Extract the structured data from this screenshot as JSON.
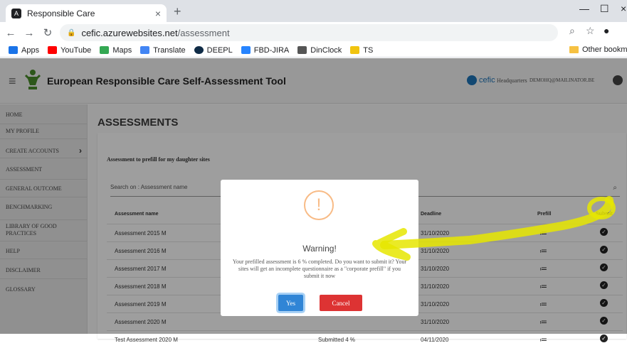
{
  "browser": {
    "tab_title": "Responsible Care",
    "tab_favicon": "A",
    "url_domain": "cefic.azurewebsites.net",
    "url_path": "/assessment",
    "bookmarks": [
      {
        "label": "Apps",
        "icon": "apps-grid-icon",
        "color": "#1a73e8"
      },
      {
        "label": "YouTube",
        "icon": "youtube-icon",
        "color": "#ff0000"
      },
      {
        "label": "Maps",
        "icon": "maps-icon",
        "color": "#34a853"
      },
      {
        "label": "Translate",
        "icon": "translate-icon",
        "color": "#4285f4"
      },
      {
        "label": "DEEPL",
        "icon": "deepl-icon",
        "color": "#0f2b46"
      },
      {
        "label": "FBD-JIRA",
        "icon": "jira-icon",
        "color": "#2684ff"
      },
      {
        "label": "DinClock",
        "icon": "hourglass-icon",
        "color": "#555555"
      },
      {
        "label": "TS",
        "icon": "ts-icon",
        "color": "#f1c40f"
      }
    ],
    "other_bookmarks": "Other bookmar"
  },
  "app": {
    "title": "European Responsible Care Self-Assessment Tool",
    "brand": "cefic",
    "location": "Headquarters",
    "user": "DEMOHQ@MAILINATOR.BE"
  },
  "sidebar": {
    "items": [
      {
        "label": "HOME"
      },
      {
        "label": "MY PROFILE"
      },
      {
        "label": "CREATE ACCOUNTS"
      },
      {
        "label": "ASSESSMENT"
      },
      {
        "label": "GENERAL OUTCOME"
      },
      {
        "label": "BENCHMARKING"
      },
      {
        "label": "LIBRARY OF GOOD PRACTICES"
      },
      {
        "label": "HELP"
      },
      {
        "label": "DISCLAIMER"
      },
      {
        "label": "GLOSSARY"
      }
    ]
  },
  "main": {
    "page_title": "ASSESSMENTS",
    "card_title": "Assessment to prefill for my daughter sites",
    "search_placeholder": "Search on : Assessment name",
    "columns": {
      "name": "Assessment name",
      "deadline": "Deadline",
      "prefill": "Prefill",
      "submit": "Submit"
    },
    "rows": [
      {
        "name": "Assessment 2015 M",
        "status": "",
        "deadline": "31/10/2020"
      },
      {
        "name": "Assessment 2016 M",
        "status": "",
        "deadline": "31/10/2020"
      },
      {
        "name": "Assessment 2017 M",
        "status": "",
        "deadline": "31/10/2020"
      },
      {
        "name": "Assessment 2018 M",
        "status": "",
        "deadline": "31/10/2020"
      },
      {
        "name": "Assessment 2019 M",
        "status": "",
        "deadline": "31/10/2020"
      },
      {
        "name": "Assessment 2020 M",
        "status": "",
        "deadline": "31/10/2020"
      },
      {
        "name": "Test Assessment 2020 M",
        "status": "Submitted 4 %",
        "deadline": "04/11/2020"
      }
    ]
  },
  "modal": {
    "icon": "!",
    "title": "Warning!",
    "message": "Your prefilled assessment is 6 % completed. Do you want to submit it? Your sites will get an incomplete questionnaire as a \"corporate prefill\" if you submit it now",
    "yes_label": "Yes",
    "cancel_label": "Cancel"
  },
  "colors": {
    "primary": "#3085d6",
    "danger": "#dd3333",
    "warning": "#f8bb86",
    "highlight": "#e6e600"
  }
}
